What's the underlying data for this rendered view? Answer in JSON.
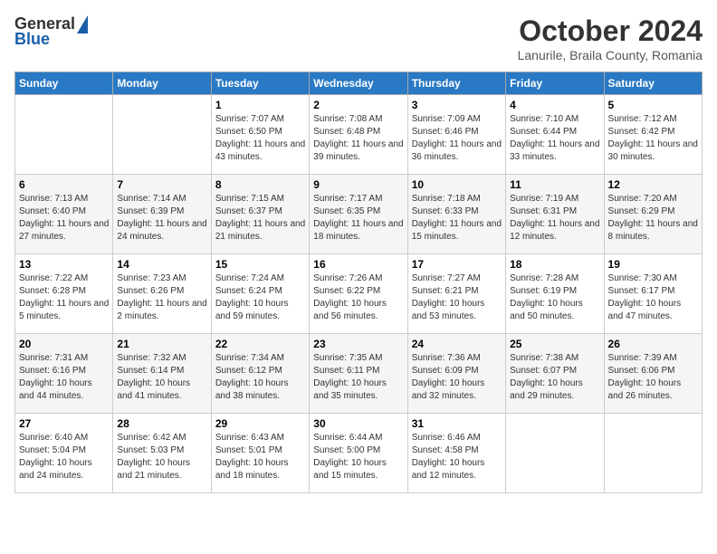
{
  "header": {
    "logo_general": "General",
    "logo_blue": "Blue",
    "month_title": "October 2024",
    "location": "Lanurile, Braila County, Romania"
  },
  "weekdays": [
    "Sunday",
    "Monday",
    "Tuesday",
    "Wednesday",
    "Thursday",
    "Friday",
    "Saturday"
  ],
  "weeks": [
    [
      {
        "day": "",
        "sunrise": "",
        "sunset": "",
        "daylight": ""
      },
      {
        "day": "",
        "sunrise": "",
        "sunset": "",
        "daylight": ""
      },
      {
        "day": "1",
        "sunrise": "Sunrise: 7:07 AM",
        "sunset": "Sunset: 6:50 PM",
        "daylight": "Daylight: 11 hours and 43 minutes."
      },
      {
        "day": "2",
        "sunrise": "Sunrise: 7:08 AM",
        "sunset": "Sunset: 6:48 PM",
        "daylight": "Daylight: 11 hours and 39 minutes."
      },
      {
        "day": "3",
        "sunrise": "Sunrise: 7:09 AM",
        "sunset": "Sunset: 6:46 PM",
        "daylight": "Daylight: 11 hours and 36 minutes."
      },
      {
        "day": "4",
        "sunrise": "Sunrise: 7:10 AM",
        "sunset": "Sunset: 6:44 PM",
        "daylight": "Daylight: 11 hours and 33 minutes."
      },
      {
        "day": "5",
        "sunrise": "Sunrise: 7:12 AM",
        "sunset": "Sunset: 6:42 PM",
        "daylight": "Daylight: 11 hours and 30 minutes."
      }
    ],
    [
      {
        "day": "6",
        "sunrise": "Sunrise: 7:13 AM",
        "sunset": "Sunset: 6:40 PM",
        "daylight": "Daylight: 11 hours and 27 minutes."
      },
      {
        "day": "7",
        "sunrise": "Sunrise: 7:14 AM",
        "sunset": "Sunset: 6:39 PM",
        "daylight": "Daylight: 11 hours and 24 minutes."
      },
      {
        "day": "8",
        "sunrise": "Sunrise: 7:15 AM",
        "sunset": "Sunset: 6:37 PM",
        "daylight": "Daylight: 11 hours and 21 minutes."
      },
      {
        "day": "9",
        "sunrise": "Sunrise: 7:17 AM",
        "sunset": "Sunset: 6:35 PM",
        "daylight": "Daylight: 11 hours and 18 minutes."
      },
      {
        "day": "10",
        "sunrise": "Sunrise: 7:18 AM",
        "sunset": "Sunset: 6:33 PM",
        "daylight": "Daylight: 11 hours and 15 minutes."
      },
      {
        "day": "11",
        "sunrise": "Sunrise: 7:19 AM",
        "sunset": "Sunset: 6:31 PM",
        "daylight": "Daylight: 11 hours and 12 minutes."
      },
      {
        "day": "12",
        "sunrise": "Sunrise: 7:20 AM",
        "sunset": "Sunset: 6:29 PM",
        "daylight": "Daylight: 11 hours and 8 minutes."
      }
    ],
    [
      {
        "day": "13",
        "sunrise": "Sunrise: 7:22 AM",
        "sunset": "Sunset: 6:28 PM",
        "daylight": "Daylight: 11 hours and 5 minutes."
      },
      {
        "day": "14",
        "sunrise": "Sunrise: 7:23 AM",
        "sunset": "Sunset: 6:26 PM",
        "daylight": "Daylight: 11 hours and 2 minutes."
      },
      {
        "day": "15",
        "sunrise": "Sunrise: 7:24 AM",
        "sunset": "Sunset: 6:24 PM",
        "daylight": "Daylight: 10 hours and 59 minutes."
      },
      {
        "day": "16",
        "sunrise": "Sunrise: 7:26 AM",
        "sunset": "Sunset: 6:22 PM",
        "daylight": "Daylight: 10 hours and 56 minutes."
      },
      {
        "day": "17",
        "sunrise": "Sunrise: 7:27 AM",
        "sunset": "Sunset: 6:21 PM",
        "daylight": "Daylight: 10 hours and 53 minutes."
      },
      {
        "day": "18",
        "sunrise": "Sunrise: 7:28 AM",
        "sunset": "Sunset: 6:19 PM",
        "daylight": "Daylight: 10 hours and 50 minutes."
      },
      {
        "day": "19",
        "sunrise": "Sunrise: 7:30 AM",
        "sunset": "Sunset: 6:17 PM",
        "daylight": "Daylight: 10 hours and 47 minutes."
      }
    ],
    [
      {
        "day": "20",
        "sunrise": "Sunrise: 7:31 AM",
        "sunset": "Sunset: 6:16 PM",
        "daylight": "Daylight: 10 hours and 44 minutes."
      },
      {
        "day": "21",
        "sunrise": "Sunrise: 7:32 AM",
        "sunset": "Sunset: 6:14 PM",
        "daylight": "Daylight: 10 hours and 41 minutes."
      },
      {
        "day": "22",
        "sunrise": "Sunrise: 7:34 AM",
        "sunset": "Sunset: 6:12 PM",
        "daylight": "Daylight: 10 hours and 38 minutes."
      },
      {
        "day": "23",
        "sunrise": "Sunrise: 7:35 AM",
        "sunset": "Sunset: 6:11 PM",
        "daylight": "Daylight: 10 hours and 35 minutes."
      },
      {
        "day": "24",
        "sunrise": "Sunrise: 7:36 AM",
        "sunset": "Sunset: 6:09 PM",
        "daylight": "Daylight: 10 hours and 32 minutes."
      },
      {
        "day": "25",
        "sunrise": "Sunrise: 7:38 AM",
        "sunset": "Sunset: 6:07 PM",
        "daylight": "Daylight: 10 hours and 29 minutes."
      },
      {
        "day": "26",
        "sunrise": "Sunrise: 7:39 AM",
        "sunset": "Sunset: 6:06 PM",
        "daylight": "Daylight: 10 hours and 26 minutes."
      }
    ],
    [
      {
        "day": "27",
        "sunrise": "Sunrise: 6:40 AM",
        "sunset": "Sunset: 5:04 PM",
        "daylight": "Daylight: 10 hours and 24 minutes."
      },
      {
        "day": "28",
        "sunrise": "Sunrise: 6:42 AM",
        "sunset": "Sunset: 5:03 PM",
        "daylight": "Daylight: 10 hours and 21 minutes."
      },
      {
        "day": "29",
        "sunrise": "Sunrise: 6:43 AM",
        "sunset": "Sunset: 5:01 PM",
        "daylight": "Daylight: 10 hours and 18 minutes."
      },
      {
        "day": "30",
        "sunrise": "Sunrise: 6:44 AM",
        "sunset": "Sunset: 5:00 PM",
        "daylight": "Daylight: 10 hours and 15 minutes."
      },
      {
        "day": "31",
        "sunrise": "Sunrise: 6:46 AM",
        "sunset": "Sunset: 4:58 PM",
        "daylight": "Daylight: 10 hours and 12 minutes."
      },
      {
        "day": "",
        "sunrise": "",
        "sunset": "",
        "daylight": ""
      },
      {
        "day": "",
        "sunrise": "",
        "sunset": "",
        "daylight": ""
      }
    ]
  ]
}
